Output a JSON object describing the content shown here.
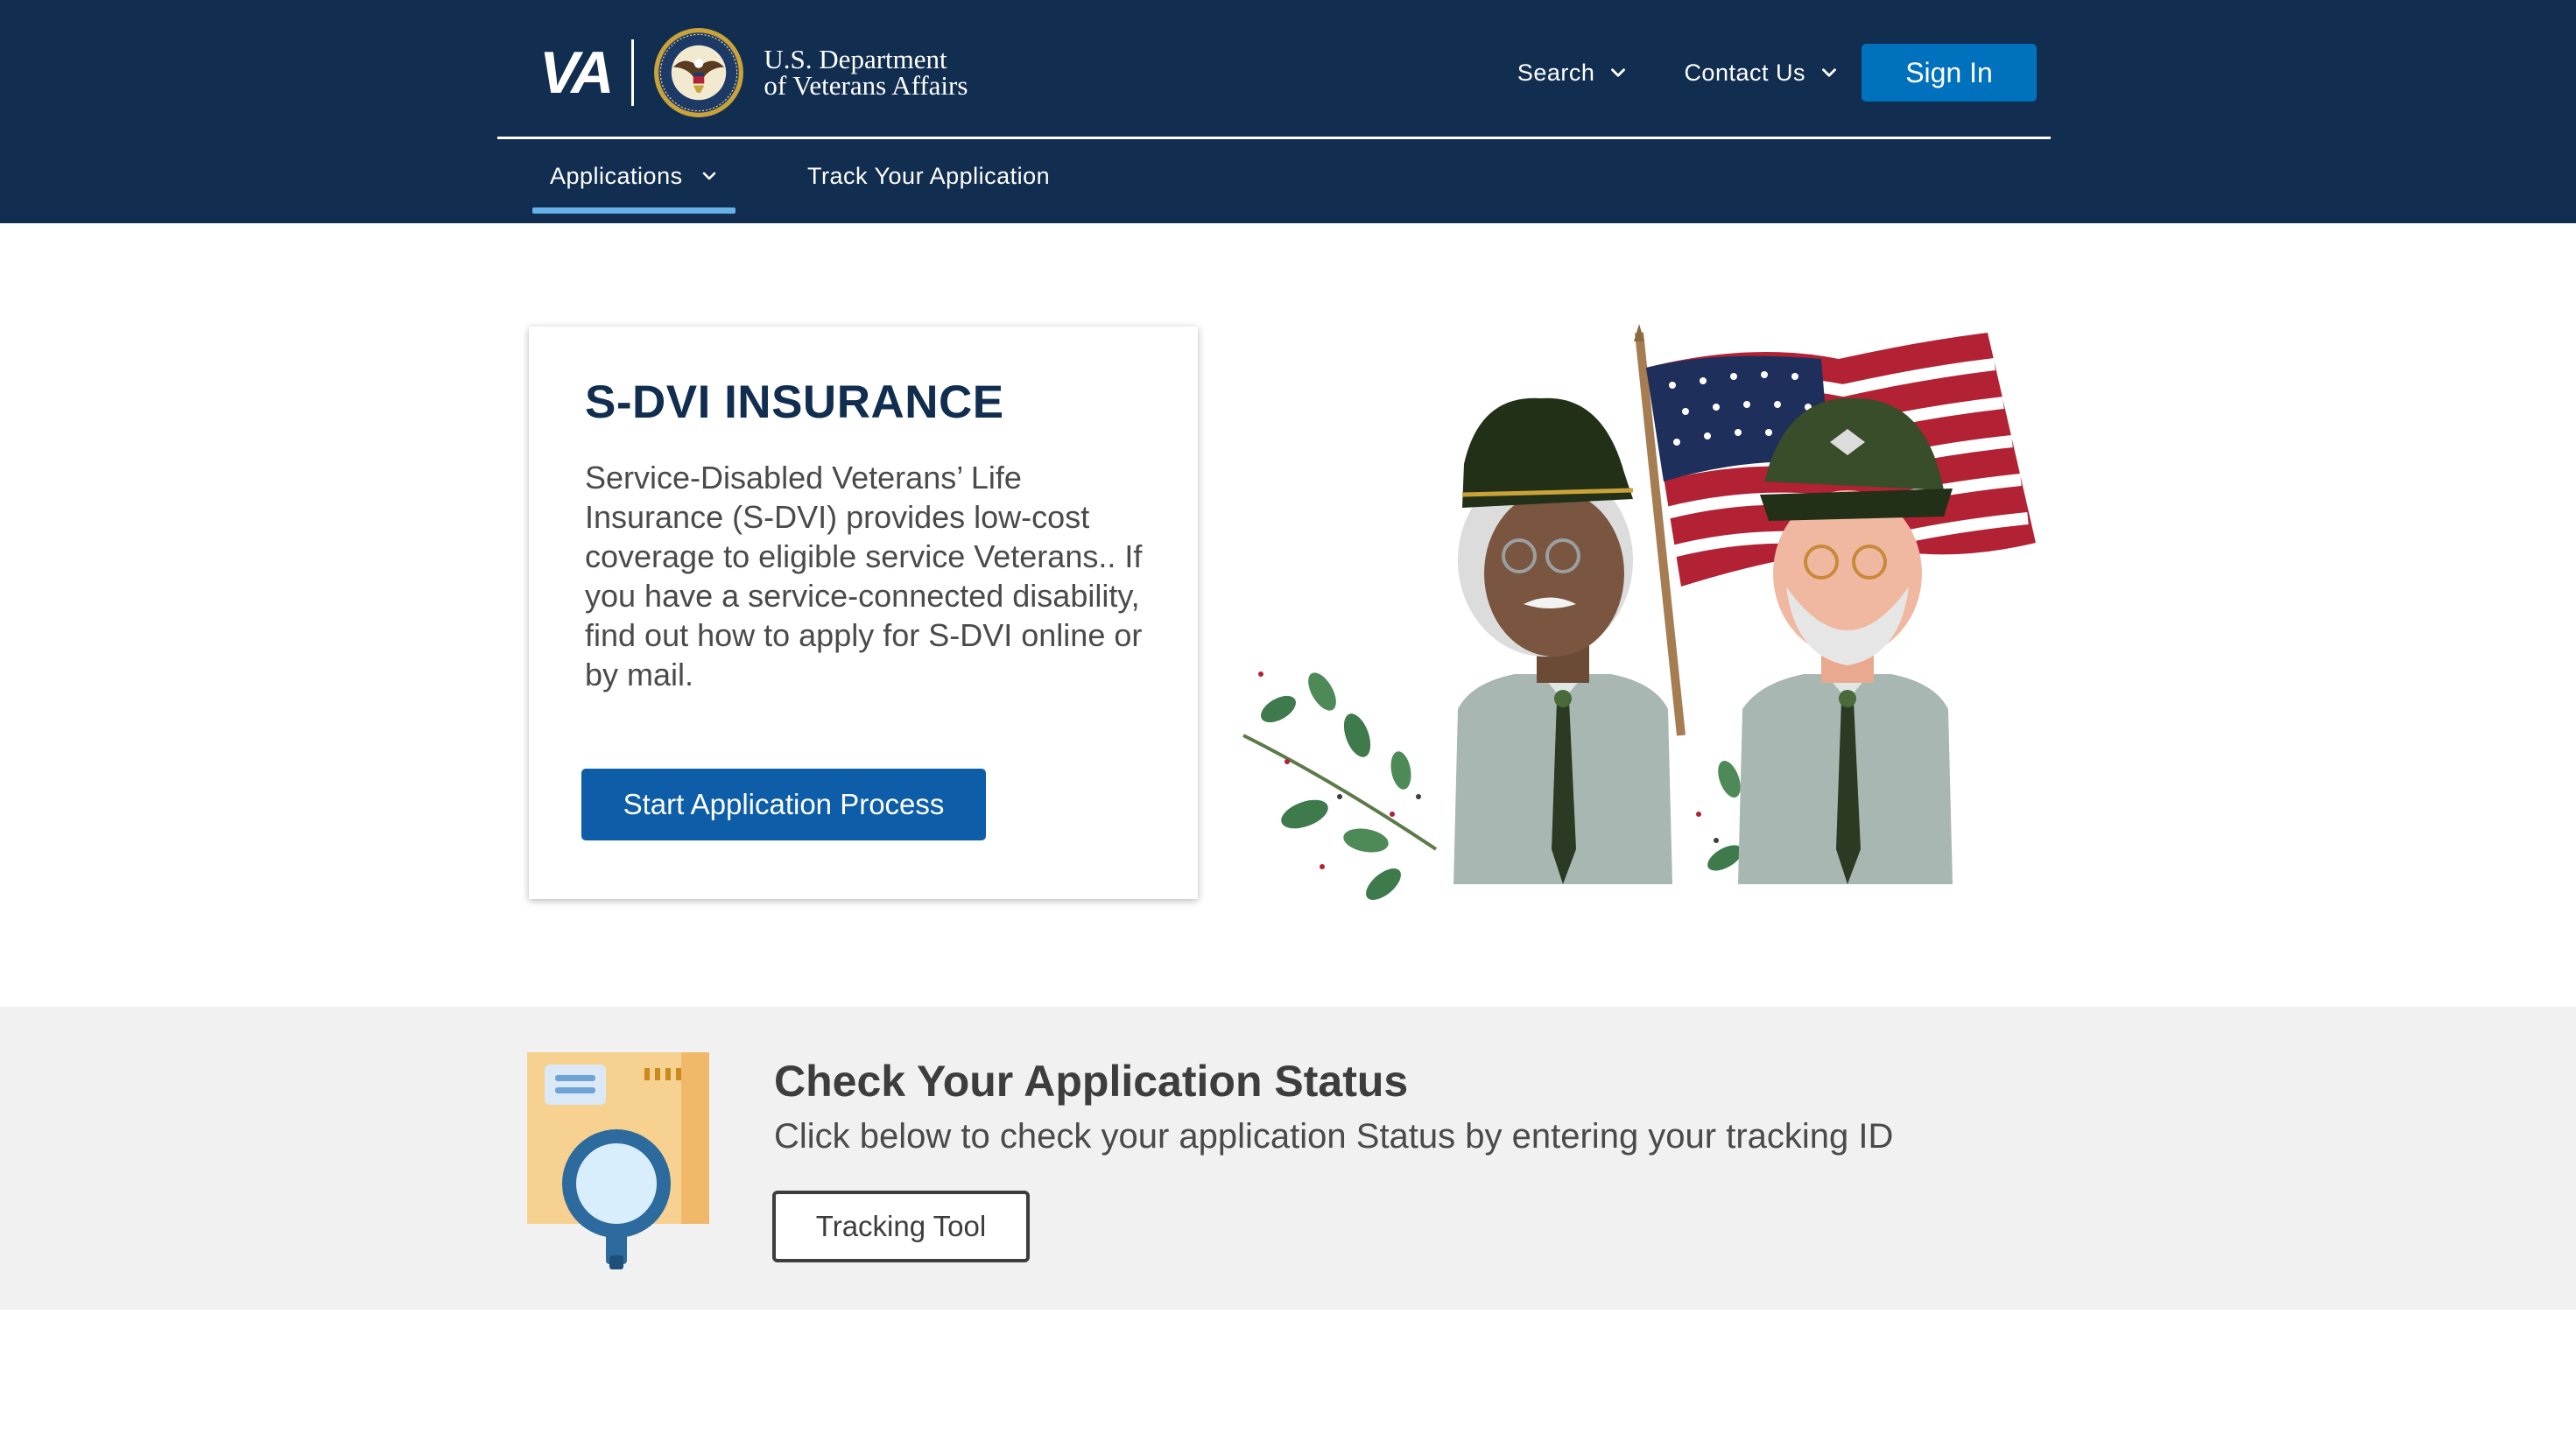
{
  "header": {
    "logo_mark": "VA",
    "dept_line1": "U.S. Department",
    "dept_line2": "of Veterans Affairs",
    "search_label": "Search",
    "contact_label": "Contact Us",
    "sign_in_label": "Sign In",
    "subnav": {
      "applications_label": "Applications",
      "track_label": "Track Your Application"
    }
  },
  "hero": {
    "title": "S-DVI INSURANCE",
    "description": "Service-Disabled Veterans’ Life Insurance (S-DVI) provides low-cost coverage to eligible service Veterans.. If you have a service-connected disability, find out how to apply for S-DVI online or by mail.",
    "cta_label": "Start Application Process"
  },
  "status": {
    "title": "Check Your Application Status",
    "text": "Click below to check your application Status by entering your tracking ID",
    "button_label": "Tracking Tool"
  },
  "icons": {
    "seal": "va-seal-icon",
    "dropdown": "chevron-down-icon",
    "tracking": "magnifier-envelope-icon"
  },
  "colors": {
    "header_bg": "#112e51",
    "primary_button": "#0071bc",
    "active_tab_underline": "#66b2e8",
    "band_bg": "#f1f1f1"
  }
}
